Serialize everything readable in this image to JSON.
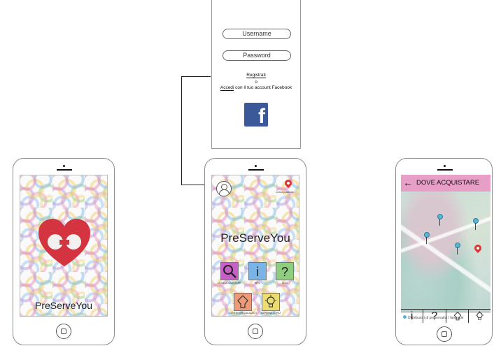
{
  "login": {
    "username_placeholder": "Username",
    "password_placeholder": "Password",
    "register_link": "Registrati",
    "or_text": "o",
    "login_link": "Accedi",
    "login_suffix": " con il tuo account Facebook",
    "facebook_logo": "f"
  },
  "splash": {
    "app_name": "PreServeYou"
  },
  "home": {
    "location_label": "La tua posizione",
    "app_name": "PreServeYou",
    "tiles": [
      {
        "icon": "search-icon",
        "glyph": "",
        "label": "DOVE ACQUISTARE",
        "color": "#c85ec8"
      },
      {
        "icon": "info-icon",
        "glyph": "i",
        "label": "INFO",
        "color": "#7ab4e6"
      },
      {
        "icon": "quiz-icon",
        "glyph": "?",
        "label": "QUIZ",
        "color": "#8fce7e"
      },
      {
        "icon": "condom-icon",
        "glyph": "",
        "label": "CENTRI SPECIALIZZATI",
        "color": "#ee9a78"
      },
      {
        "icon": "bulb-icon",
        "glyph": "",
        "label": "SAPERNE DI PIU'",
        "color": "#ecdd72"
      }
    ]
  },
  "map_screen": {
    "title": "DOVE ACQUISTARE",
    "back_arrow": "←",
    "header_color": "#e79fc8",
    "legend_text": "Distributori di preservativi / farmacie",
    "bottom_nav": [
      "i",
      "?",
      "",
      ""
    ]
  },
  "colors": {
    "heart": "#d3343f",
    "facebook": "#3b5998",
    "red_pin": "#d33333"
  }
}
